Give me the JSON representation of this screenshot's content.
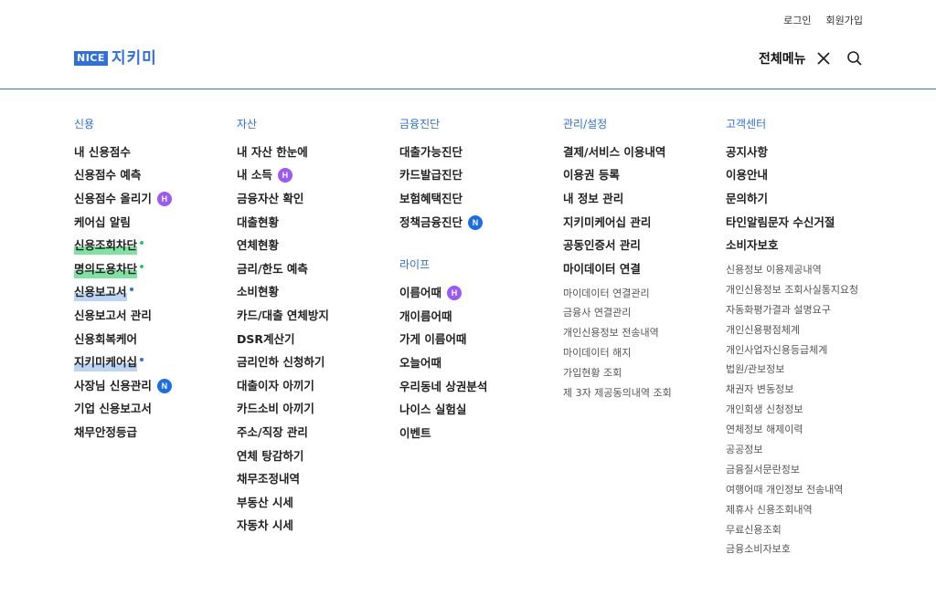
{
  "top_links": {
    "login": "로그인",
    "signup": "회원가입"
  },
  "logo": {
    "brand": "NICE",
    "name": "지키미"
  },
  "header": {
    "menu_label": "전체메뉴"
  },
  "colors": {
    "accent": "#2f6fe0",
    "badge_h": "#9b59f5",
    "badge_n": "#1a6fe8",
    "highlight_green": "#7ee3a0"
  },
  "col1": {
    "title": "신용",
    "items": [
      "내 신용점수",
      "신용점수 예측",
      "신용점수 올리기",
      "케어십 알림",
      "신용조회차단",
      "명의도용차단",
      "신용보고서",
      "신용보고서 관리",
      "신용회복케어",
      "지키미케어십",
      "사장님 신용관리",
      "기업 신용보고서",
      "채무안정등급"
    ],
    "badge_h": "H",
    "badge_n": "N"
  },
  "col2": {
    "title": "자산",
    "items": [
      "내 자산 한눈에",
      "내 소득",
      "금융자산 확인",
      "대출현황",
      "연체현황",
      "금리/한도 예측",
      "소비현황",
      "카드/대출 연체방지",
      "DSR계산기",
      "금리인하 신청하기",
      "대출이자 아끼기",
      "카드소비 아끼기",
      "주소/직장 관리",
      "연체 탕감하기",
      "채무조정내역",
      "부동산 시세",
      "자동차 시세"
    ],
    "badge_h": "H"
  },
  "col3": {
    "title": "금융진단",
    "items": [
      "대출가능진단",
      "카드발급진단",
      "보험혜택진단",
      "정책금융진단"
    ],
    "badge_n": "N",
    "title2": "라이프",
    "items2": [
      "이름어때",
      "개이름어때",
      "가게 이름어때",
      "오늘어때",
      "우리동네 상권분석",
      "나이스 실험실",
      "이벤트"
    ],
    "badge_h": "H"
  },
  "col4": {
    "title": "관리/설정",
    "items": [
      "결제/서비스 이용내역",
      "이용권 등록",
      "내 정보 관리",
      "지키미케어십 관리",
      "공동인증서 관리",
      "마이데이터 연결"
    ],
    "subs": [
      "마이데이터 연결관리",
      "금융사 연결관리",
      "개인신용정보 전송내역",
      "마이데이터 해지",
      "가입현황 조회",
      "제 3자 제공동의내역 조회"
    ]
  },
  "col5": {
    "title": "고객센터",
    "items": [
      "공지사항",
      "이용안내",
      "문의하기",
      "타인알림문자 수신거절",
      "소비자보호"
    ],
    "subs": [
      "신용정보 이용제공내역",
      "개인신용정보 조회사실통지요청",
      "자동화평가결과 설명요구",
      "개인신용평점체계",
      "개인사업자신용등급체계",
      "법원/관보정보",
      "채권자 변동정보",
      "개인회생 신청정보",
      "연체정보 해제이력",
      "공공정보",
      "금융질서문란정보",
      "여행어때 개인정보 전송내역",
      "제휴사 신용조회내역",
      "무료신용조회",
      "금융소비자보호"
    ]
  }
}
